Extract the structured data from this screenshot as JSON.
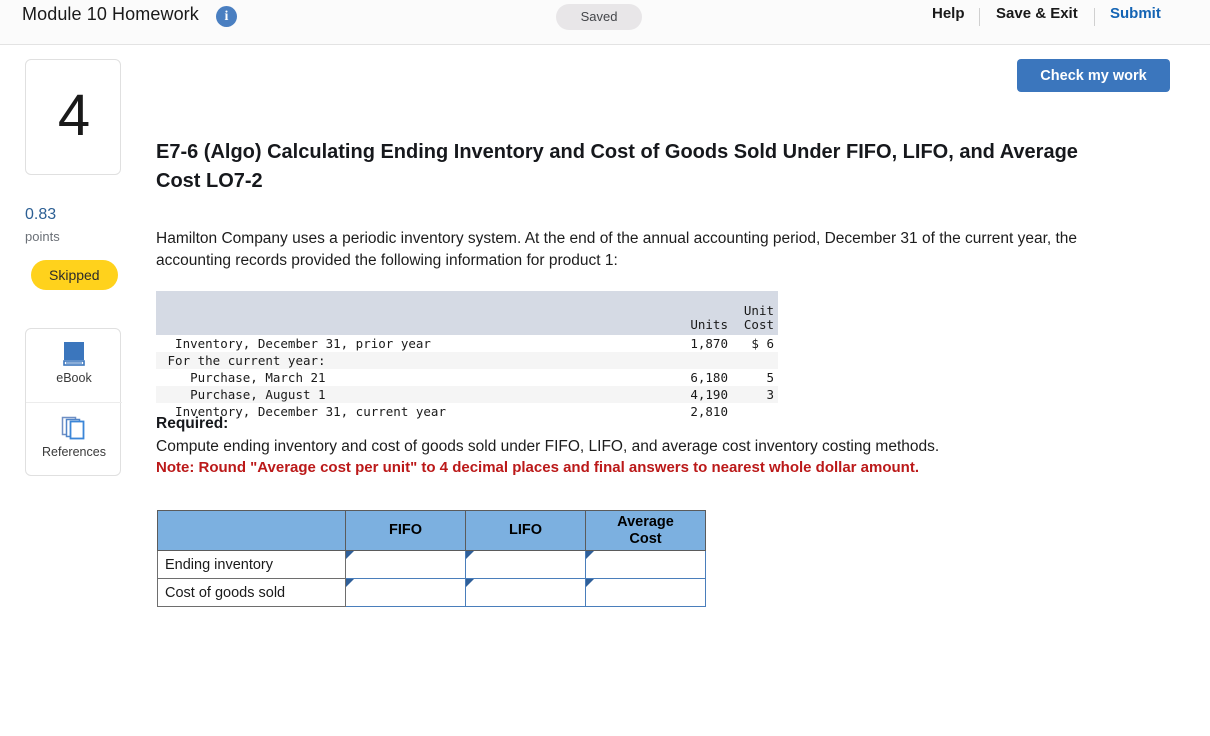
{
  "topbar": {
    "title": "Module 10 Homework",
    "info_icon": "info-icon",
    "saved_status": "Saved",
    "help_label": "Help",
    "save_exit_label": "Save & Exit",
    "submit_label": "Submit"
  },
  "sidebar": {
    "question_number": "4",
    "points_value": "0.83",
    "points_label": "points",
    "status_badge": "Skipped",
    "tools": [
      {
        "label": "eBook",
        "icon": "book-icon"
      },
      {
        "label": "References",
        "icon": "pages-icon"
      }
    ]
  },
  "actions": {
    "check_my_work": "Check my work"
  },
  "question": {
    "title": "E7-6 (Algo) Calculating Ending Inventory and Cost of Goods Sold Under FIFO, LIFO, and Average Cost LO7-2",
    "intro": "Hamilton Company uses a periodic inventory system. At the end of the annual accounting period, December 31 of the current year, the accounting records provided the following information for product 1:",
    "required_label": "Required:",
    "required_text": "Compute ending inventory and cost of goods sold under FIFO, LIFO, and average cost inventory costing methods.",
    "required_note": "Note: Round \"Average cost per unit\" to 4 decimal places and final answers to nearest whole dollar amount."
  },
  "fact_table": {
    "headers": {
      "label": "",
      "units": "Units",
      "unit_cost_line1": "Unit",
      "unit_cost_line2": "Cost"
    },
    "rows": [
      {
        "label": "  Inventory, December 31, prior year",
        "units": "1,870",
        "unit_cost": "$ 6",
        "alt": false
      },
      {
        "label": " For the current year:",
        "units": "",
        "unit_cost": "",
        "alt": true
      },
      {
        "label": "    Purchase, March 21",
        "units": "6,180",
        "unit_cost": "5",
        "alt": false
      },
      {
        "label": "    Purchase, August 1",
        "units": "4,190",
        "unit_cost": "3",
        "alt": true
      },
      {
        "label": "  Inventory, December 31, current year",
        "units": "2,810",
        "unit_cost": "",
        "alt": false
      }
    ]
  },
  "answer_table": {
    "headers": [
      "",
      "FIFO",
      "LIFO",
      "Average Cost"
    ],
    "header_avg_line1": "Average",
    "header_avg_line2": "Cost",
    "rows": [
      {
        "label": "Ending inventory",
        "fifo": "",
        "lifo": "",
        "average": ""
      },
      {
        "label": "Cost of goods sold",
        "fifo": "",
        "lifo": "",
        "average": ""
      }
    ]
  }
}
